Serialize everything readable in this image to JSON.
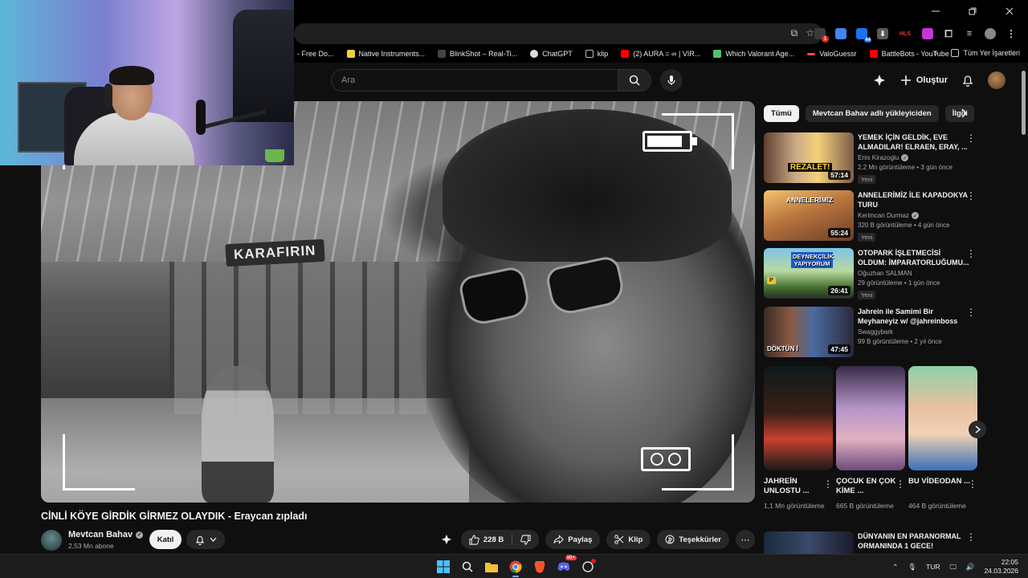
{
  "browser": {
    "bookmarks": [
      {
        "label": "- Free Do...",
        "color": "#000000"
      },
      {
        "label": "Native Instruments...",
        "color": "#e8d23a"
      },
      {
        "label": "BlinkShot – Real-Ti...",
        "color": "#444444"
      },
      {
        "label": "ChatGPT",
        "color": "#dddddd"
      },
      {
        "label": "klip",
        "color": "#bbbbbb"
      },
      {
        "label": "(2) AURA = ∞ | VIR...",
        "color": "#ff0000"
      },
      {
        "label": "Which Valorant Age...",
        "color": "#55c26c"
      },
      {
        "label": "ValoGuessr",
        "color": "#ff4655"
      },
      {
        "label": "BattleBots - YouTube",
        "color": "#ff0000"
      }
    ],
    "bookmarks_more": "»",
    "all_bookmarks": "Tüm Yer İşaretleri",
    "extension_badges": [
      "1",
      "44"
    ]
  },
  "header": {
    "search_placeholder": "Ara",
    "create_label": "Oluştur"
  },
  "video": {
    "title": "CİNLİ KÖYE GİRDİK GİRMEZ OLAYDIK - Eraycan zıpladı",
    "store_sign": "KARAFIRIN",
    "battery_level": 0.85,
    "channel": {
      "name": "Mevtcan Bahav",
      "subscribers": "2,53 Mn abone"
    },
    "join_label": "Katıl",
    "likes": "228 B",
    "share_label": "Paylaş",
    "clip_label": "Klip",
    "thanks_label": "Teşekkürler"
  },
  "sidebar": {
    "chips": [
      {
        "label": "Tümü",
        "active": true
      },
      {
        "label": "Mevtcan Bahav adlı yükleyiciden",
        "active": false
      },
      {
        "label": "İlgili",
        "active": false
      }
    ],
    "recommendations": [
      {
        "title": "YEMEK İÇİN GELDİK, EVE ALMADILAR! ELRAEN, ERAY, ...",
        "channel": "Enis Kirazoglu",
        "verified": true,
        "meta": "2,2 Mn görüntüleme • 3 gün önce",
        "badge": "Yeni",
        "duration": "57:14",
        "thumb_text": "REZALET!"
      },
      {
        "title": "ANNELERİMİZ İLE KAPADOKYA TURU",
        "channel": "Kerimcan Durmaz",
        "verified": true,
        "meta": "320 B görüntüleme • 4 gün önce",
        "badge": "Yeni",
        "duration": "55:24",
        "thumb_text": "ANNELERİMİZ"
      },
      {
        "title": "OTOPARK İŞLETMECİSİ OLDUM: İMPARATORLUĞUMU...",
        "channel": "Oğuzhan SALMAN",
        "verified": false,
        "meta": "29 görüntüleme • 1 gün önce",
        "badge": "Yeni",
        "duration": "26:41",
        "thumb_text": "DEYNEKÇİLİK YAPIYORUM"
      },
      {
        "title": "Jahrein ile Samimi Bir Meyhaneyiz w/ @jahreinboss",
        "channel": "Swaggybark",
        "verified": false,
        "meta": "99 B görüntüleme • 2 yıl önce",
        "badge": "",
        "duration": "47:45",
        "thumb_text": "DÖKTÜN İ"
      }
    ],
    "shorts": [
      {
        "title": "JAHREİN UNLOSTU ...",
        "views": "1,1 Mn görüntüleme"
      },
      {
        "title": "ÇOCUK EN ÇOK KİME ...",
        "views": "665 B görüntüleme"
      },
      {
        "title": "BU VİDEODAN ...",
        "views": "464 B görüntüleme"
      }
    ],
    "last_rec_title": "DÜNYANIN EN PARANORMAL ORMANINDA 1 GECE!"
  },
  "taskbar": {
    "language": "TUR",
    "time": "22:05",
    "date": "24.03.2026",
    "discord_badge": "99+"
  },
  "icons": {
    "search": "search-icon",
    "mic": "mic-icon",
    "bell": "bell-icon",
    "like": "thumbs-up-icon",
    "dislike": "thumbs-down-icon",
    "share": "share-icon",
    "clip": "scissors-icon",
    "thanks": "thanks-icon",
    "more": "more-icon"
  }
}
